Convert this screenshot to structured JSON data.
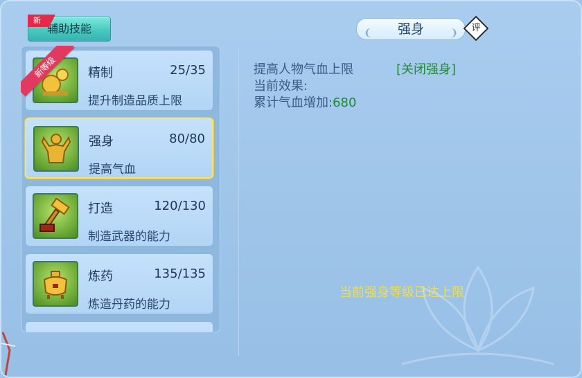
{
  "header": {
    "tab_label": "辅助技能",
    "tab_badge": "新",
    "panel_title": "强身",
    "rate_label": "评"
  },
  "skills": [
    {
      "name": "精制",
      "count": "25/35",
      "desc": "提升制造品质上限",
      "ribbon": "新等级",
      "icon": "refine-icon",
      "selected": false
    },
    {
      "name": "强身",
      "count": "80/80",
      "desc": "提高气血",
      "ribbon": "",
      "icon": "strength-icon",
      "selected": true
    },
    {
      "name": "打造",
      "count": "120/130",
      "desc": "制造武器的能力",
      "ribbon": "",
      "icon": "hammer-icon",
      "selected": false
    },
    {
      "name": "炼药",
      "count": "135/135",
      "desc": "炼造丹药的能力",
      "ribbon": "",
      "icon": "cauldron-icon",
      "selected": false
    }
  ],
  "detail": {
    "line1": "提高人物气血上限",
    "close_link": "[关闭强身]",
    "line2": "当前效果:",
    "line3_label": "累计气血增加:",
    "line3_value": "680",
    "max_message": "当前强身等级已达上限"
  },
  "colors": {
    "accent_green": "#1e8a2e",
    "highlight_yellow": "#f2dd4a",
    "ribbon_red": "#e23a5f"
  }
}
